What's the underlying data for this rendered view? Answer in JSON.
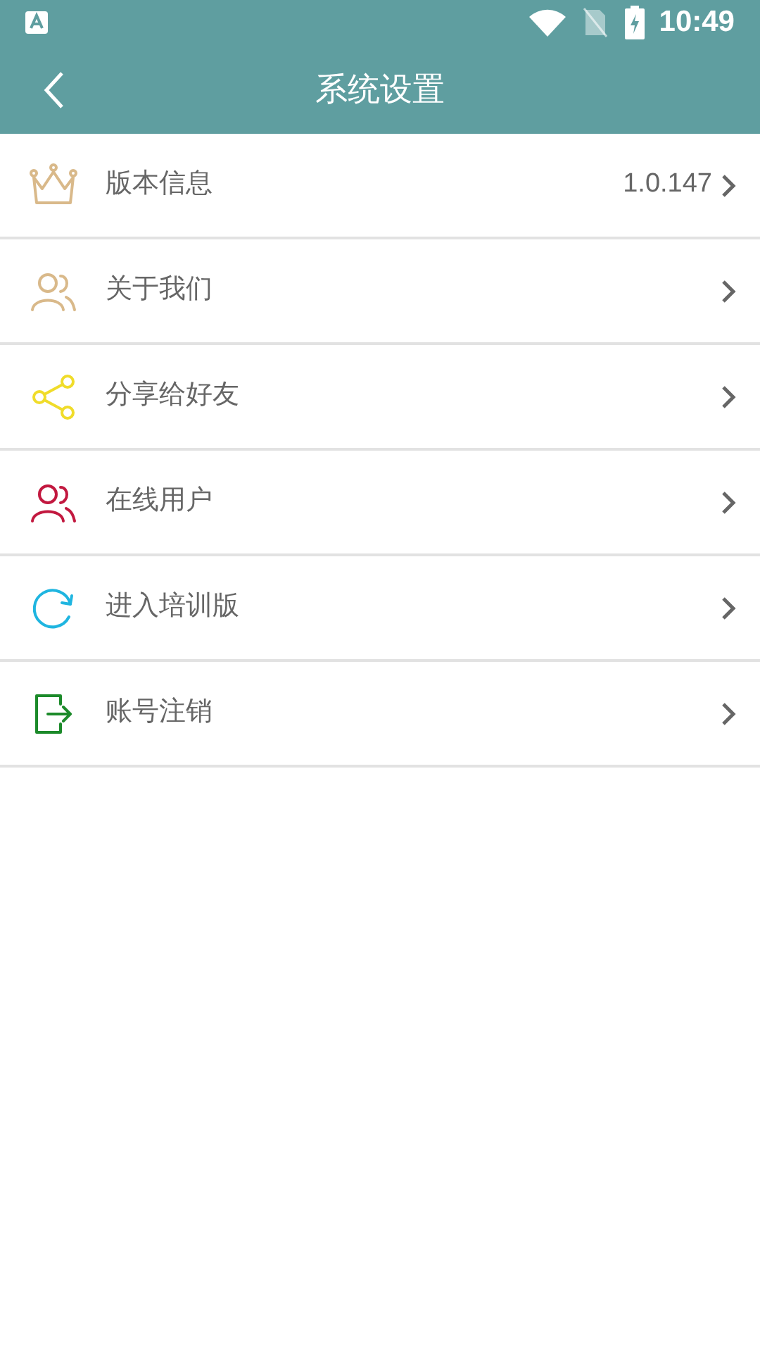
{
  "status_bar": {
    "time": "10:49"
  },
  "header": {
    "title": "系统设置"
  },
  "items": [
    {
      "kind": "crown",
      "color": "#d9b98a",
      "label": "版本信息",
      "value": "1.0.147"
    },
    {
      "kind": "users",
      "color": "#d9b98a",
      "label": "关于我们"
    },
    {
      "kind": "share",
      "color": "#f0dc2a",
      "label": "分享给好友"
    },
    {
      "kind": "users",
      "color": "#c2183f",
      "label": "在线用户"
    },
    {
      "kind": "refresh",
      "color": "#1fb5e0",
      "label": "进入培训版"
    },
    {
      "kind": "exit",
      "color": "#1c8a2a",
      "label": "账号注销"
    }
  ]
}
